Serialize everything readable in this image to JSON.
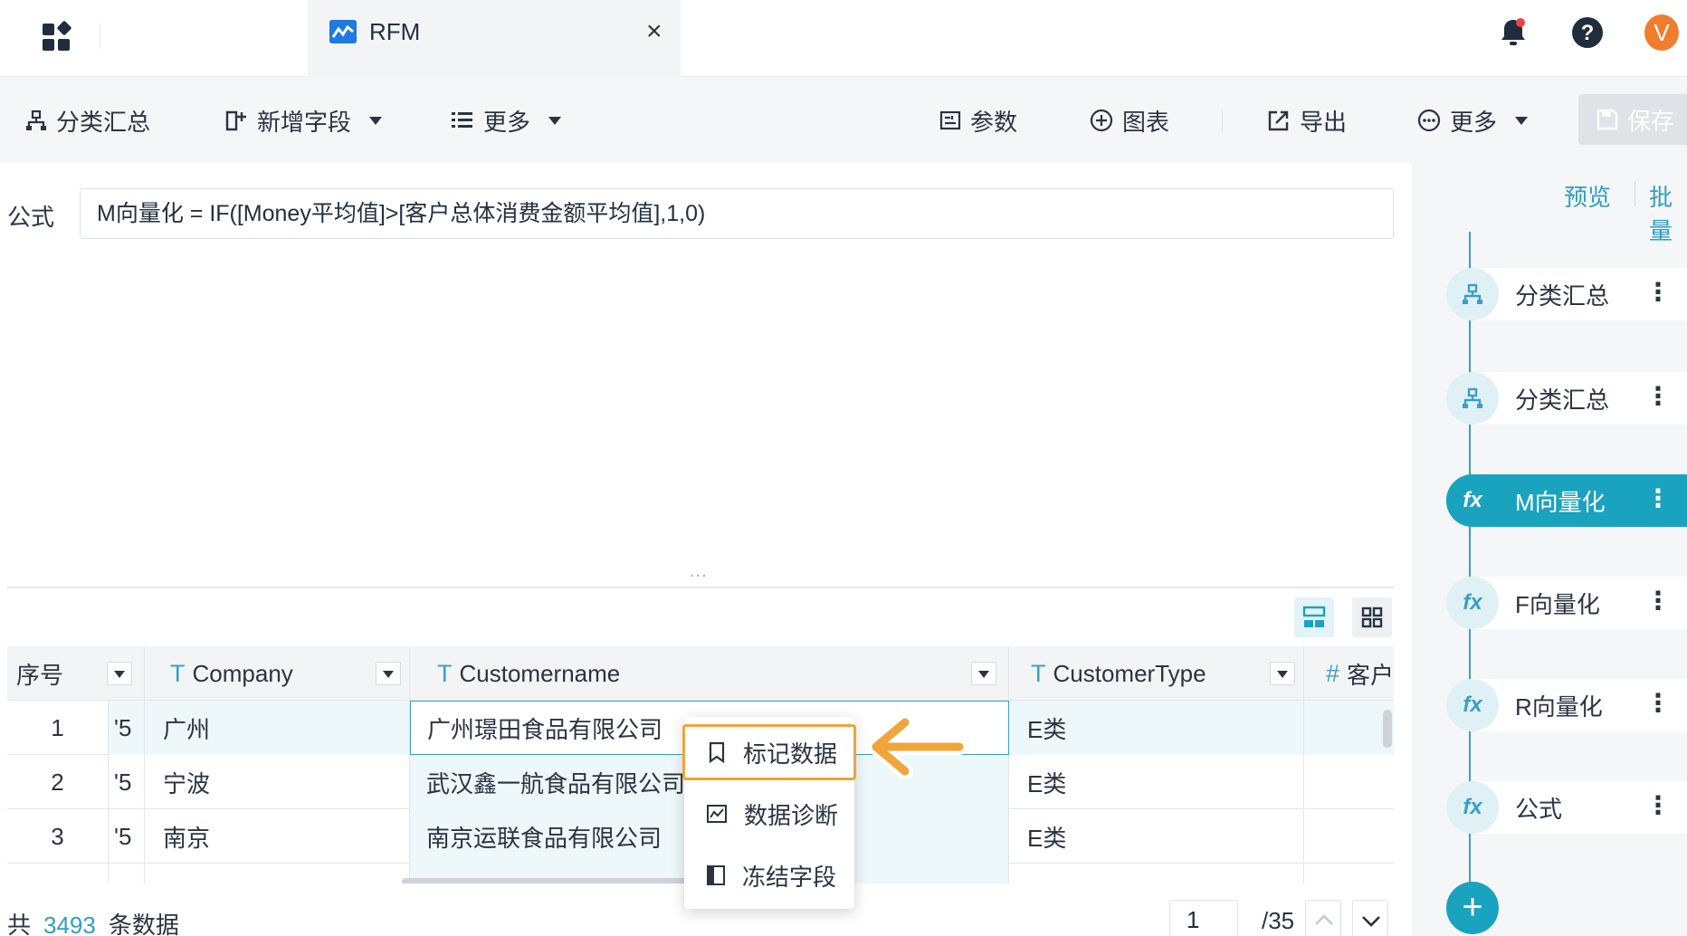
{
  "tab": {
    "title": "RFM",
    "close": "×"
  },
  "user": {
    "avatar_letter": "V"
  },
  "toolbar": {
    "group_summary": "分类汇总",
    "add_field": "新增字段",
    "more_left": "更多",
    "params": "参数",
    "chart": "图表",
    "export": "导出",
    "more_right": "更多",
    "save": "保存"
  },
  "formula": {
    "label": "公式",
    "value": "M向量化 = IF([Money平均值]>[客户总体消费金额平均值],1,0)"
  },
  "splitter": "...",
  "table": {
    "headers": [
      "序号",
      "Company",
      "Customername",
      "CustomerType",
      "客户"
    ],
    "rows": [
      {
        "index": "1",
        "prev": "'5",
        "company": "广州",
        "customername": "广州璟田食品有限公司",
        "type": "E类"
      },
      {
        "index": "2",
        "prev": "'5",
        "company": "宁波",
        "customername": "武汉鑫一航食品有限公司",
        "type": "E类"
      },
      {
        "index": "3",
        "prev": "'5",
        "company": "南京",
        "customername": "南京运联食品有限公司",
        "type": "E类"
      }
    ]
  },
  "context_menu": {
    "items": [
      "标记数据",
      "数据诊断",
      "冻结字段"
    ]
  },
  "footer": {
    "prefix": "共",
    "total_rows": "3493",
    "suffix": "条数据",
    "current_page": "1",
    "total_pages": "/35"
  },
  "right_panel": {
    "preview": "预览",
    "batch": "批量",
    "steps": [
      {
        "label": "分类汇总",
        "icon": "group-summary-icon",
        "active": false
      },
      {
        "label": "分类汇总",
        "icon": "group-summary-icon",
        "active": false
      },
      {
        "label": "M向量化",
        "icon": "fx-icon",
        "active": true
      },
      {
        "label": "F向量化",
        "icon": "fx-icon",
        "active": false
      },
      {
        "label": "R向量化",
        "icon": "fx-icon",
        "active": false
      },
      {
        "label": "公式",
        "icon": "fx-icon",
        "active": false
      }
    ],
    "add": "+"
  },
  "colors": {
    "accent": "#1aa3bf",
    "highlight": "#f0a43a",
    "link": "#2f9ec3"
  }
}
